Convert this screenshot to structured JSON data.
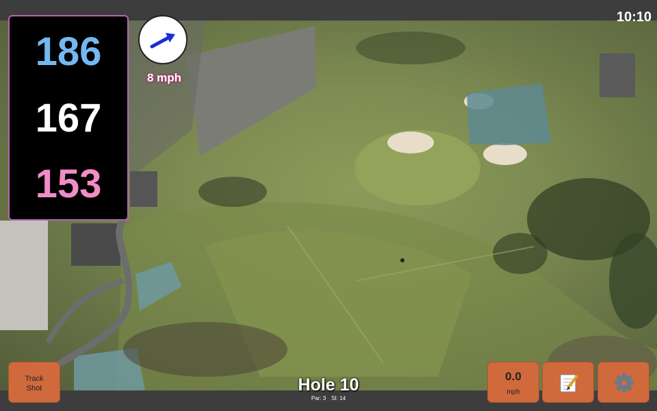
{
  "status": {
    "time": "10:10"
  },
  "distances": {
    "back": "186",
    "middle": "167",
    "front": "153"
  },
  "wind": {
    "speed_label": "8 mph",
    "direction_icon": "wind-arrow-icon"
  },
  "buttons": {
    "track_shot": "Track\nShot",
    "speed_value": "0.0",
    "speed_unit": "mph",
    "notes_icon": "notepad-icon",
    "settings_icon": "gear-icon"
  },
  "hole": {
    "title": "Hole 10",
    "par": "Par: 3",
    "stroke_index": "SI: 14"
  },
  "colors": {
    "back": "#74b8f2",
    "middle": "#ffffff",
    "front": "#f28cc8",
    "button": "#d0693c",
    "frame": "#b565b5"
  }
}
